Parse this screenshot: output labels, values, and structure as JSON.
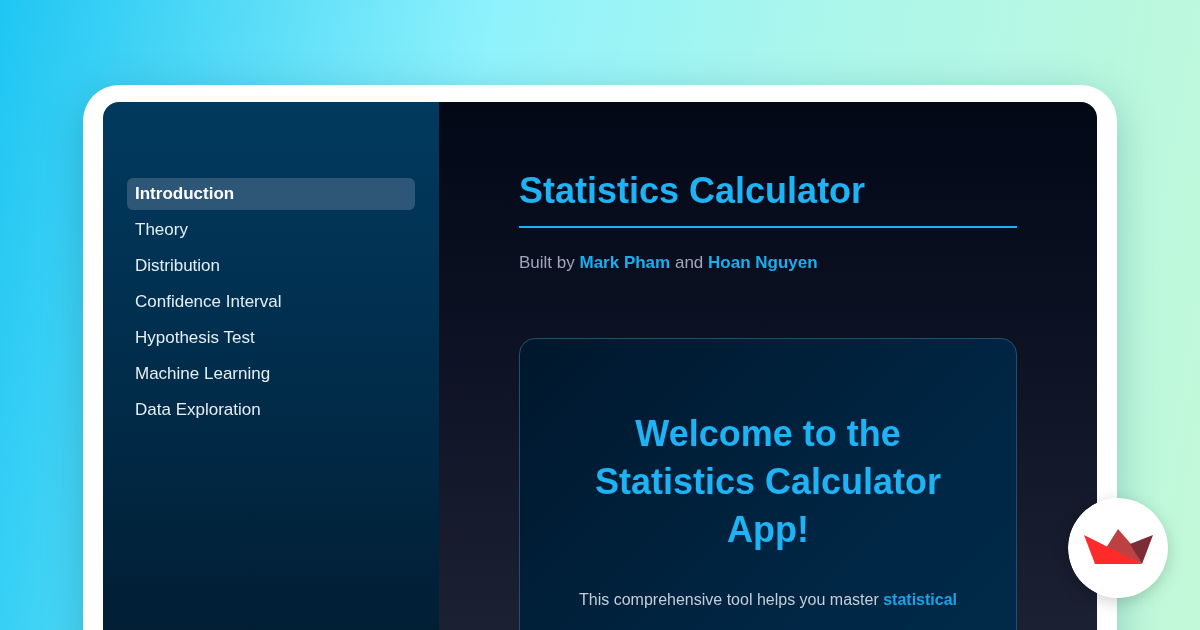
{
  "sidebar": {
    "items": [
      {
        "label": "Introduction",
        "selected": true
      },
      {
        "label": "Theory",
        "selected": false
      },
      {
        "label": "Distribution",
        "selected": false
      },
      {
        "label": "Confidence Interval",
        "selected": false
      },
      {
        "label": "Hypothesis Test",
        "selected": false
      },
      {
        "label": "Machine Learning",
        "selected": false
      },
      {
        "label": "Data Exploration",
        "selected": false
      }
    ]
  },
  "main": {
    "title": "Statistics Calculator",
    "byline": [
      {
        "kind": "text",
        "text": "Built by"
      },
      {
        "kind": "link",
        "text": "Mark Pham"
      },
      {
        "kind": "text",
        "text": "and"
      },
      {
        "kind": "link",
        "text": "Hoan Nguyen"
      }
    ],
    "card": {
      "heading": "Welcome to the Statistics Calculator App!",
      "paragraph": [
        {
          "kind": "text",
          "text": "This comprehensive tool helps you master"
        },
        {
          "kind": "link",
          "text": "statistical"
        }
      ]
    }
  }
}
